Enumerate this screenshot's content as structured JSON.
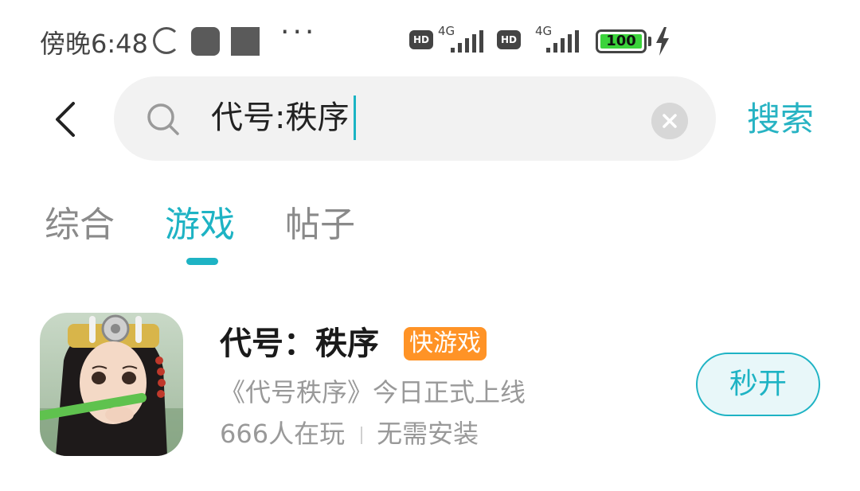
{
  "status_bar": {
    "time": "傍晚6:48",
    "more": "···",
    "hd": "HD",
    "network_1": "4G",
    "network_2": "4G",
    "battery": "100"
  },
  "search": {
    "query": "代号:秩序",
    "button_label": "搜索"
  },
  "tabs": [
    {
      "label": "综合",
      "active": false
    },
    {
      "label": "游戏",
      "active": true
    },
    {
      "label": "帖子",
      "active": false
    }
  ],
  "game": {
    "title": "代号：秩序",
    "badge": "快游戏",
    "description": "《代号秩序》今日正式上线",
    "players": "666人在玩",
    "install": "无需安装",
    "open_button": "秒开"
  },
  "colors": {
    "accent": "#1eb3c4",
    "badge": "#ff9326",
    "battery": "#3bd33b"
  }
}
